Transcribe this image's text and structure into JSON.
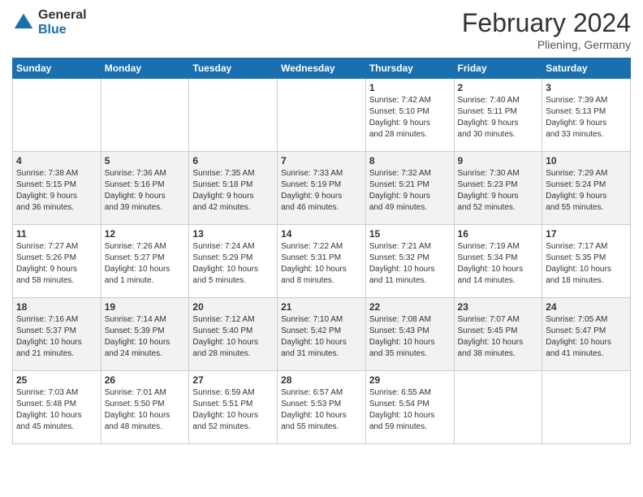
{
  "header": {
    "logo_general": "General",
    "logo_blue": "Blue",
    "month_title": "February 2024",
    "location": "Pliening, Germany"
  },
  "weekdays": [
    "Sunday",
    "Monday",
    "Tuesday",
    "Wednesday",
    "Thursday",
    "Friday",
    "Saturday"
  ],
  "weeks": [
    [
      {
        "day": "",
        "info": ""
      },
      {
        "day": "",
        "info": ""
      },
      {
        "day": "",
        "info": ""
      },
      {
        "day": "",
        "info": ""
      },
      {
        "day": "1",
        "info": "Sunrise: 7:42 AM\nSunset: 5:10 PM\nDaylight: 9 hours\nand 28 minutes."
      },
      {
        "day": "2",
        "info": "Sunrise: 7:40 AM\nSunset: 5:11 PM\nDaylight: 9 hours\nand 30 minutes."
      },
      {
        "day": "3",
        "info": "Sunrise: 7:39 AM\nSunset: 5:13 PM\nDaylight: 9 hours\nand 33 minutes."
      }
    ],
    [
      {
        "day": "4",
        "info": "Sunrise: 7:38 AM\nSunset: 5:15 PM\nDaylight: 9 hours\nand 36 minutes."
      },
      {
        "day": "5",
        "info": "Sunrise: 7:36 AM\nSunset: 5:16 PM\nDaylight: 9 hours\nand 39 minutes."
      },
      {
        "day": "6",
        "info": "Sunrise: 7:35 AM\nSunset: 5:18 PM\nDaylight: 9 hours\nand 42 minutes."
      },
      {
        "day": "7",
        "info": "Sunrise: 7:33 AM\nSunset: 5:19 PM\nDaylight: 9 hours\nand 46 minutes."
      },
      {
        "day": "8",
        "info": "Sunrise: 7:32 AM\nSunset: 5:21 PM\nDaylight: 9 hours\nand 49 minutes."
      },
      {
        "day": "9",
        "info": "Sunrise: 7:30 AM\nSunset: 5:23 PM\nDaylight: 9 hours\nand 52 minutes."
      },
      {
        "day": "10",
        "info": "Sunrise: 7:29 AM\nSunset: 5:24 PM\nDaylight: 9 hours\nand 55 minutes."
      }
    ],
    [
      {
        "day": "11",
        "info": "Sunrise: 7:27 AM\nSunset: 5:26 PM\nDaylight: 9 hours\nand 58 minutes."
      },
      {
        "day": "12",
        "info": "Sunrise: 7:26 AM\nSunset: 5:27 PM\nDaylight: 10 hours\nand 1 minute."
      },
      {
        "day": "13",
        "info": "Sunrise: 7:24 AM\nSunset: 5:29 PM\nDaylight: 10 hours\nand 5 minutes."
      },
      {
        "day": "14",
        "info": "Sunrise: 7:22 AM\nSunset: 5:31 PM\nDaylight: 10 hours\nand 8 minutes."
      },
      {
        "day": "15",
        "info": "Sunrise: 7:21 AM\nSunset: 5:32 PM\nDaylight: 10 hours\nand 11 minutes."
      },
      {
        "day": "16",
        "info": "Sunrise: 7:19 AM\nSunset: 5:34 PM\nDaylight: 10 hours\nand 14 minutes."
      },
      {
        "day": "17",
        "info": "Sunrise: 7:17 AM\nSunset: 5:35 PM\nDaylight: 10 hours\nand 18 minutes."
      }
    ],
    [
      {
        "day": "18",
        "info": "Sunrise: 7:16 AM\nSunset: 5:37 PM\nDaylight: 10 hours\nand 21 minutes."
      },
      {
        "day": "19",
        "info": "Sunrise: 7:14 AM\nSunset: 5:39 PM\nDaylight: 10 hours\nand 24 minutes."
      },
      {
        "day": "20",
        "info": "Sunrise: 7:12 AM\nSunset: 5:40 PM\nDaylight: 10 hours\nand 28 minutes."
      },
      {
        "day": "21",
        "info": "Sunrise: 7:10 AM\nSunset: 5:42 PM\nDaylight: 10 hours\nand 31 minutes."
      },
      {
        "day": "22",
        "info": "Sunrise: 7:08 AM\nSunset: 5:43 PM\nDaylight: 10 hours\nand 35 minutes."
      },
      {
        "day": "23",
        "info": "Sunrise: 7:07 AM\nSunset: 5:45 PM\nDaylight: 10 hours\nand 38 minutes."
      },
      {
        "day": "24",
        "info": "Sunrise: 7:05 AM\nSunset: 5:47 PM\nDaylight: 10 hours\nand 41 minutes."
      }
    ],
    [
      {
        "day": "25",
        "info": "Sunrise: 7:03 AM\nSunset: 5:48 PM\nDaylight: 10 hours\nand 45 minutes."
      },
      {
        "day": "26",
        "info": "Sunrise: 7:01 AM\nSunset: 5:50 PM\nDaylight: 10 hours\nand 48 minutes."
      },
      {
        "day": "27",
        "info": "Sunrise: 6:59 AM\nSunset: 5:51 PM\nDaylight: 10 hours\nand 52 minutes."
      },
      {
        "day": "28",
        "info": "Sunrise: 6:57 AM\nSunset: 5:53 PM\nDaylight: 10 hours\nand 55 minutes."
      },
      {
        "day": "29",
        "info": "Sunrise: 6:55 AM\nSunset: 5:54 PM\nDaylight: 10 hours\nand 59 minutes."
      },
      {
        "day": "",
        "info": ""
      },
      {
        "day": "",
        "info": ""
      }
    ]
  ]
}
